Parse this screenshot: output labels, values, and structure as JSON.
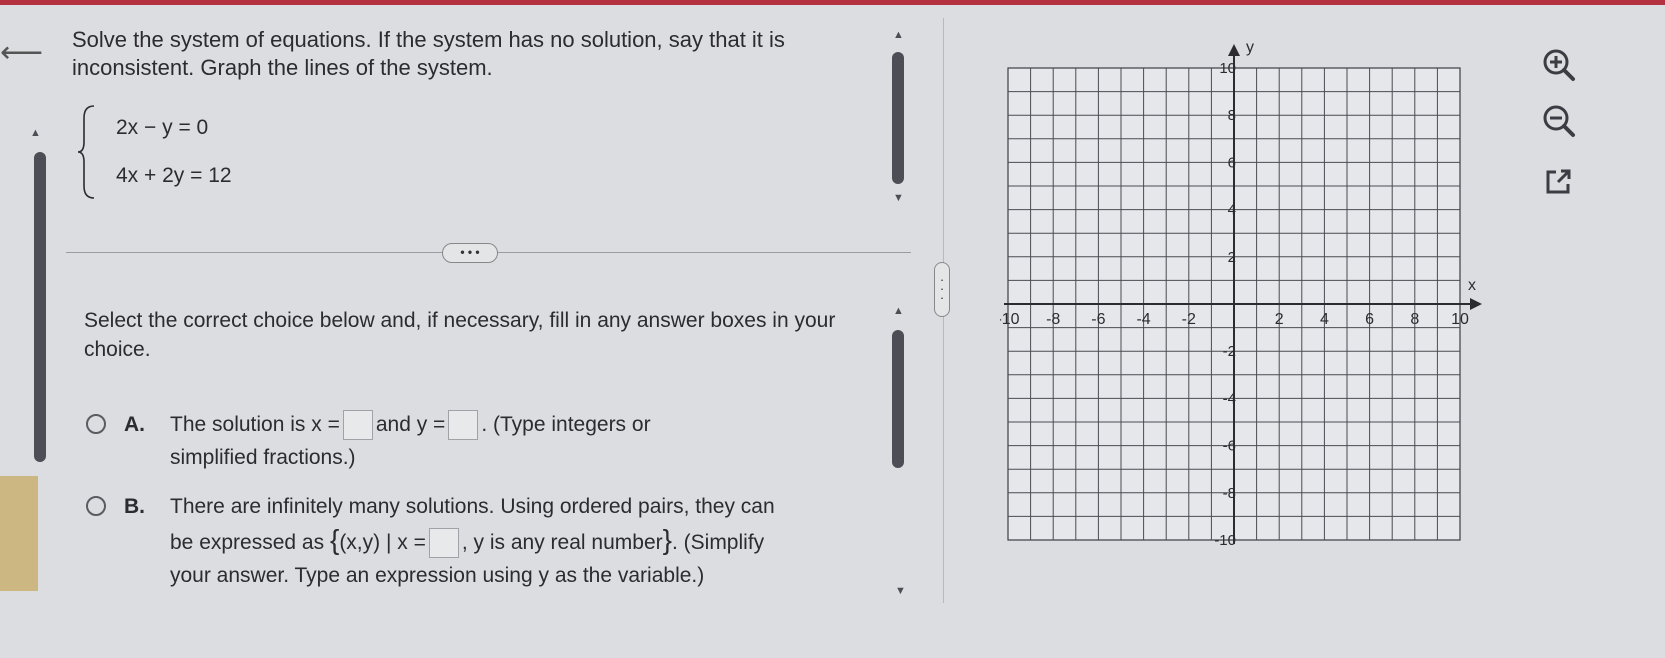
{
  "problem": {
    "prompt": "Solve the system of equations. If the system has no solution, say that it is inconsistent. Graph the lines of the system.",
    "equation1": "2x − y  = 0",
    "equation2": "4x + 2y = 12"
  },
  "more_label": "• • •",
  "instruction": "Select the correct choice below and, if necessary, fill in any answer boxes in your choice.",
  "choices": [
    {
      "letter": "A.",
      "p1": "The solution is x =",
      "p2": "and y =",
      "p3": ". (Type integers or",
      "line2": "simplified fractions.)"
    },
    {
      "letter": "B.",
      "line1": "There are infinitely many solutions. Using ordered pairs, they can",
      "p1": "be expressed as",
      "open": "{",
      "p2": "(x,y) | x =",
      "p3": ", y is any real number",
      "close": "}",
      "p4": ". (Simplify",
      "line3": "your answer. Type an expression using y as the variable.)"
    }
  ],
  "graph": {
    "x_label": "x",
    "y_label": "y",
    "x_min": -10,
    "x_max": 10,
    "y_min": -10,
    "y_max": 10,
    "x_tick_labels": [
      "-10",
      "-8",
      "-6",
      "-4",
      "-2",
      "2",
      "4",
      "6",
      "8",
      "10"
    ],
    "y_tick_labels": [
      "10",
      "8",
      "6",
      "4",
      "2",
      "-2",
      "-4",
      "-6",
      "-8",
      "-10"
    ]
  },
  "tools": [
    "zoom-in-icon",
    "zoom-out-icon",
    "popout-icon"
  ],
  "colors": {
    "accent_bar": "#b53040",
    "highlight": "#ccb682",
    "scrollbar": "#4d4d55"
  }
}
